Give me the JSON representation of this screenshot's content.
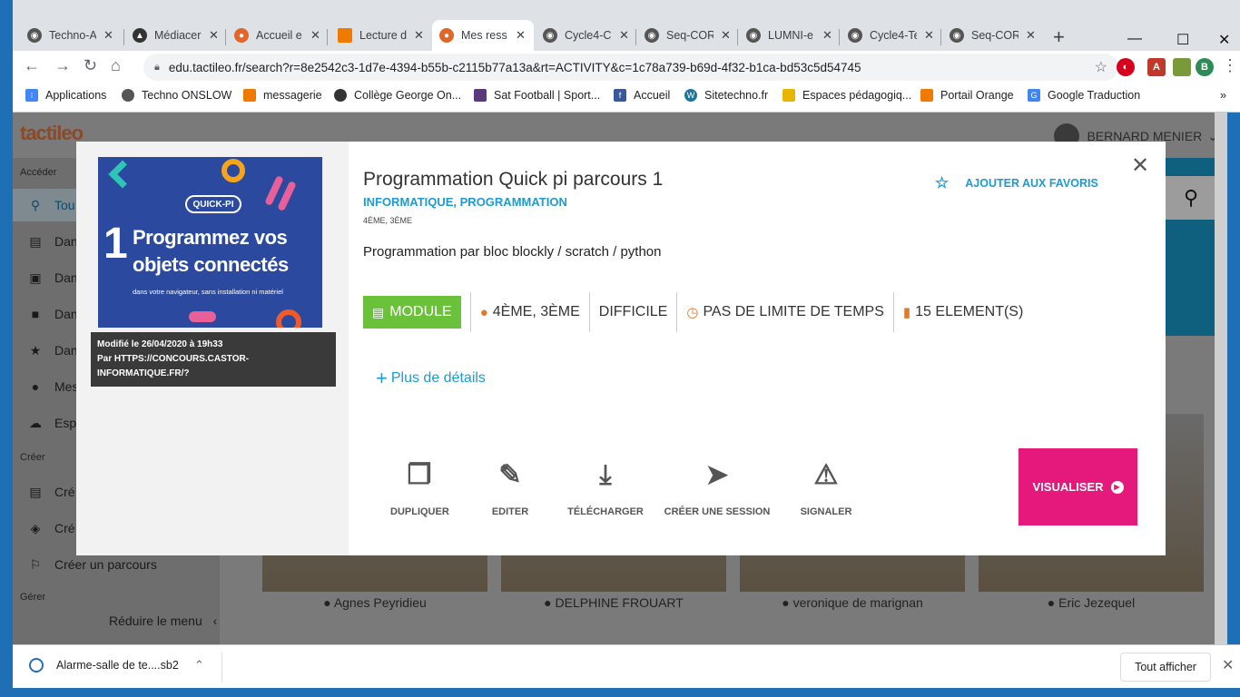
{
  "browser": {
    "tabs": [
      {
        "title": "Techno-A",
        "color": "#555"
      },
      {
        "title": "Médiacer",
        "color": "#333"
      },
      {
        "title": "Accueil e",
        "color": "#e0662a"
      },
      {
        "title": "Lecture d",
        "color": "#f07a00"
      },
      {
        "title": "Mes ress",
        "color": "#e0662a"
      },
      {
        "title": "Cycle4-C",
        "color": "#555"
      },
      {
        "title": "Seq-COR",
        "color": "#555"
      },
      {
        "title": "LUMNI-e",
        "color": "#555"
      },
      {
        "title": "Cycle4-Te",
        "color": "#555"
      },
      {
        "title": "Seq-COR",
        "color": "#555"
      }
    ],
    "url": "edu.tactileo.fr/search?r=8e2542c3-1d7e-4394-b55b-c2115b77a13a&rt=ACTIVITY&c=1c78a739-b69d-4f32-b1ca-bd53c5d54745",
    "profile_initial": "B",
    "bookmarks": [
      {
        "label": "Applications",
        "color": "#4285f4"
      },
      {
        "label": "Techno  ONSLOW",
        "color": "#555"
      },
      {
        "label": "messagerie",
        "color": "#f07a00"
      },
      {
        "label": "Collège George On...",
        "color": "#333"
      },
      {
        "label": "Sat Football | Sport...",
        "color": "#5a3a7a"
      },
      {
        "label": "Accueil",
        "color": "#3b5998"
      },
      {
        "label": "Sitetechno.fr",
        "color": "#21759b"
      },
      {
        "label": "Espaces pédagogiq...",
        "color": "#e8b500"
      },
      {
        "label": "Portail Orange",
        "color": "#f07a00"
      },
      {
        "label": "Google Traduction",
        "color": "#4285f4"
      }
    ]
  },
  "app": {
    "logo": "tactileo",
    "user": "BERNARD MENIER",
    "sidebar": {
      "section_access": "Accéder",
      "section_create": "Créer",
      "section_manage": "Gérer",
      "items": [
        "Tou",
        "Dan",
        "Dan",
        "Dan",
        "Dan",
        "Mes",
        "Esp"
      ],
      "create_items": [
        "Cré",
        "Cré",
        "Créer un parcours"
      ],
      "reduce": "Réduire le menu"
    },
    "cards": [
      "Agnes Peyridieu",
      "DELPHINE FROUART",
      "veronique de marignan",
      "Eric Jezequel"
    ]
  },
  "modal": {
    "thumbnail": {
      "badge": "QUICK-PI",
      "number": "1",
      "line1": "Programmez vos",
      "line2": "objets connectés",
      "line3": "dans votre navigateur, sans installation ni matériel"
    },
    "modified": "Modifié le 26/04/2020 à 19h33",
    "by": "Par HTTPS://CONCOURS.CASTOR-INFORMATIQUE.FR/?",
    "title": "Programmation Quick pi parcours 1",
    "subject": "INFORMATIQUE, PROGRAMMATION",
    "levels_small": "4ÈME, 3ÈME",
    "description": "Programmation par bloc blockly / scratch / python",
    "favorite": "AJOUTER AUX FAVORIS",
    "info": {
      "type": "MODULE",
      "levels": "4ÈME, 3ÈME",
      "difficulty": "DIFFICILE",
      "time": "PAS DE LIMITE DE TEMPS",
      "elements": "15 ELEMENT(S)"
    },
    "details": "Plus de détails",
    "actions": {
      "duplicate": "DUPLIQUER",
      "edit": "EDITER",
      "download": "TÉLÉCHARGER",
      "session": "CRÉER UNE SESSION",
      "report": "SIGNALER"
    },
    "view": "VISUALISER"
  },
  "download_bar": {
    "file": "Alarme-salle de te....sb2",
    "show_all": "Tout afficher"
  },
  "colors": {
    "accent": "#1d9bd1",
    "module": "#6cc13a",
    "visualiser": "#e5197c"
  }
}
